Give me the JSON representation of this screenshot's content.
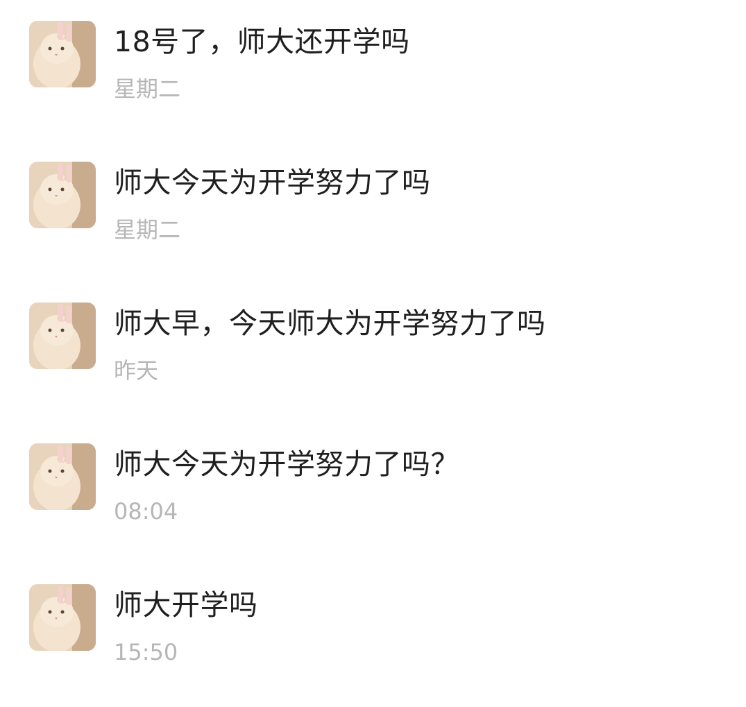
{
  "posts": [
    {
      "message": "18号了，师大还开学吗",
      "time": "星期二",
      "avatar_icon": "cat-avatar-icon"
    },
    {
      "message": "师大今天为开学努力了吗",
      "time": "星期二",
      "avatar_icon": "cat-avatar-icon"
    },
    {
      "message": "师大早，今天师大为开学努力了吗",
      "time": "昨天",
      "avatar_icon": "cat-avatar-icon"
    },
    {
      "message": "师大今天为开学努力了吗？",
      "time": "08:04",
      "avatar_icon": "cat-avatar-icon"
    },
    {
      "message": "师大开学吗",
      "time": "15:50",
      "avatar_icon": "cat-avatar-icon"
    }
  ],
  "colors": {
    "message_text": "#1f1f1f",
    "time_text": "#b6b6b6",
    "background": "#ffffff"
  }
}
